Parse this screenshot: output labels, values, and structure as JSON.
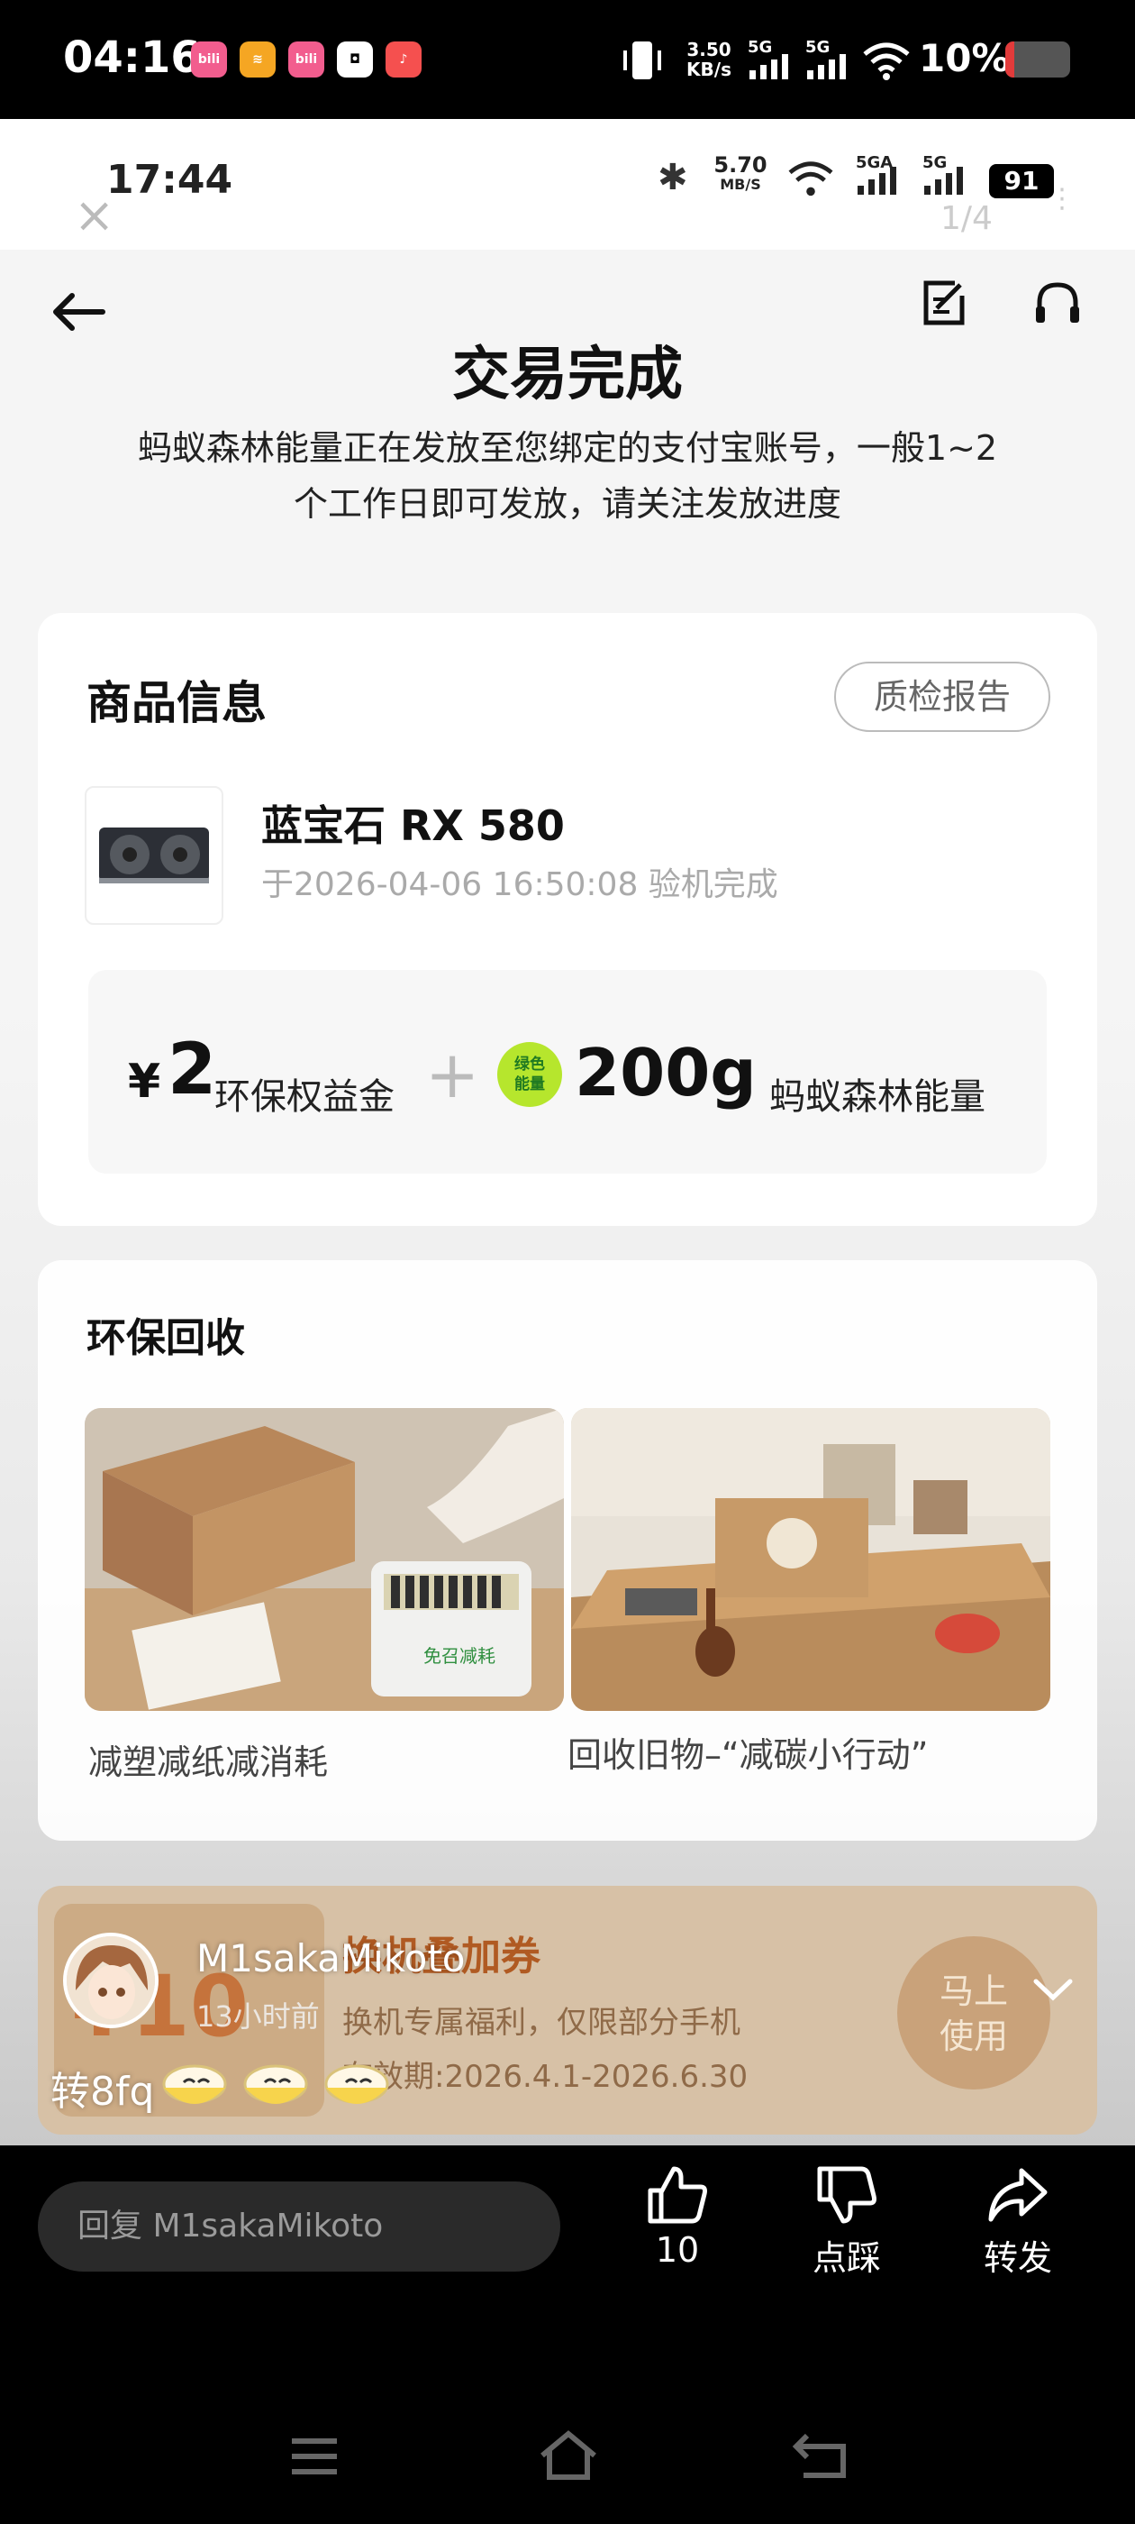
{
  "outer_status": {
    "time": "04:16",
    "net_speed_value": "3.50",
    "net_speed_unit": "KB/s",
    "signal1": "5G",
    "signal2": "5G",
    "battery": "10%"
  },
  "inner_status": {
    "time": "17:44",
    "net_speed_value": "5.70",
    "net_speed_unit": "MB/S",
    "signal1": "5GA",
    "signal2": "5G",
    "battery": "91",
    "page_counter": "1/4"
  },
  "header": {
    "title": "交易完成",
    "subtitle_line1": "蚂蚁森林能量正在发放至您绑定的支付宝账号，一般1~2",
    "subtitle_line2": "个工作日即可发放，请关注发放进度"
  },
  "product_card": {
    "heading": "商品信息",
    "report_button": "质检报告",
    "product_name": "蓝宝石 RX 580",
    "inspection_time": "于2026-04-06 16:50:08 验机完成",
    "reward_currency": "¥",
    "reward_amount": "2",
    "reward_label": "环保权益金",
    "plus": "+",
    "energy_badge_line1": "绿色",
    "energy_badge_line2": "能量",
    "energy_amount": "200g",
    "energy_label": "蚂蚁森林能量"
  },
  "recycle_card": {
    "heading": "环保回收",
    "items": [
      {
        "caption": "减塑减纸减消耗",
        "box_text": "免召减耗"
      },
      {
        "caption": "回收旧物–“减碳小行动”"
      }
    ]
  },
  "coupon_card": {
    "amount": "¥10",
    "title": "换机叠加券",
    "desc": "换机专属福利，仅限部分手机",
    "validity": "有效期:2026.4.1-2026.6.30",
    "use_button_line1": "马上",
    "use_button_line2": "使用"
  },
  "comment": {
    "username": "M1sakaMikoto",
    "time_ago": "13小时前",
    "text": "转8fq",
    "emoji_count": 3
  },
  "action_bar": {
    "reply_placeholder": "回复 M1sakaMikoto",
    "like_count": "10",
    "dislike_label": "点踩",
    "share_label": "转发"
  }
}
